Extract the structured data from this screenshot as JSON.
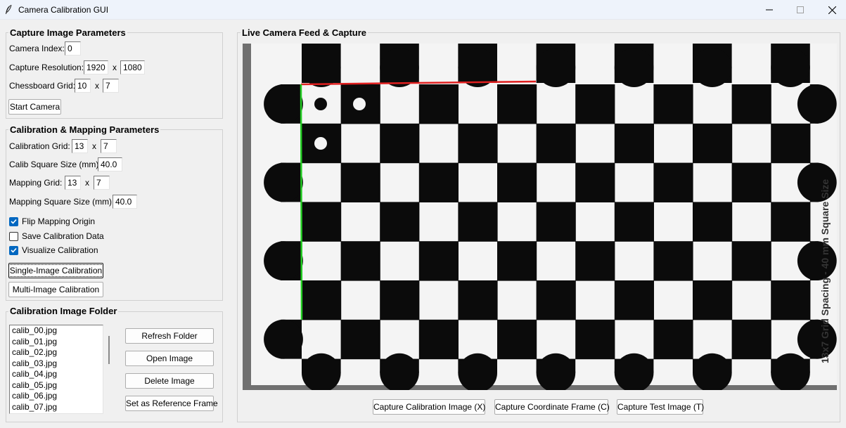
{
  "window": {
    "title": "Camera Calibration GUI"
  },
  "capture_params": {
    "title": "Capture Image Parameters",
    "camera_index_label": "Camera Index:",
    "camera_index": "0",
    "resolution_label": "Capture Resolution:",
    "resolution_w": "1920",
    "resolution_sep": "x",
    "resolution_h": "1080",
    "grid_label": "Chessboard Grid:",
    "grid_cols": "10",
    "grid_sep": "x",
    "grid_rows": "7",
    "start_button": "Start Camera"
  },
  "calib_params": {
    "title": "Calibration & Mapping Parameters",
    "calib_grid_label": "Calibration Grid:",
    "calib_grid_cols": "13",
    "calib_grid_sep": "x",
    "calib_grid_rows": "7",
    "calib_square_label": "Calib Square Size (mm):",
    "calib_square": "40.0",
    "mapping_grid_label": "Mapping Grid:",
    "mapping_grid_cols": "13",
    "mapping_grid_sep": "x",
    "mapping_grid_rows": "7",
    "mapping_square_label": "Mapping Square Size (mm):",
    "mapping_square": "40.0",
    "checkboxes": [
      {
        "label": "Flip Mapping Origin",
        "checked": true
      },
      {
        "label": "Save Calibration Data",
        "checked": false
      },
      {
        "label": "Visualize Calibration",
        "checked": true
      }
    ],
    "single_button": "Single-Image Calibration",
    "multi_button": "Multi-Image Calibration"
  },
  "folder": {
    "title": "Calibration Image Folder",
    "files": [
      "calib_00.jpg",
      "calib_01.jpg",
      "calib_02.jpg",
      "calib_03.jpg",
      "calib_04.jpg",
      "calib_05.jpg",
      "calib_06.jpg",
      "calib_07.jpg"
    ],
    "refresh_button": "Refresh Folder",
    "open_button": "Open Image",
    "delete_button": "Delete Image",
    "reference_button": "Set as Reference Frame"
  },
  "live": {
    "title": "Live Camera Feed & Capture",
    "board_caption": "13x7 Grid Spacing - 40 mm Square Size",
    "capture_calib_button": "Capture Calibration Image (X)",
    "capture_coord_button": "Capture Coordinate Frame (C)",
    "capture_test_button": "Capture Test Image (T)"
  },
  "colors": {
    "x_axis": "#e02020",
    "y_axis": "#22cc22",
    "checkbox_accent": "#0067c0"
  }
}
